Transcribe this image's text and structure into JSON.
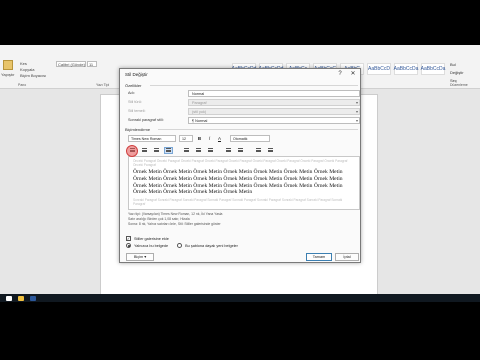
{
  "ribbon": {
    "clipboard": {
      "paste": "Yapıştır",
      "cut": "Kes",
      "copy": "Kopyala",
      "format_painter": "Biçim Boyacısı",
      "group": "Pano"
    },
    "font": {
      "name": "Calibri (Gövde)",
      "size": "11",
      "group": "Yazı Tipi"
    },
    "paragraph_group": "Paragraf",
    "styles": [
      "AaBbCcDd",
      "AaBbCcDd",
      "AaBbCc",
      "AaBbCcC",
      "AaBbC",
      "AaBbCcD",
      "AaBbCcDa",
      "AaBbCcDa"
    ],
    "editing": {
      "find": "Bul",
      "replace": "Değiştir",
      "select": "Seç",
      "group": "Düzenleme"
    }
  },
  "statusbar": {
    "page": "SAYFA 1/1",
    "words": "0 SÖZCÜK",
    "zoom": "%100"
  },
  "dialog": {
    "title": "Stil Değiştir",
    "help": "?",
    "close": "✕",
    "properties_header": "Özellikler",
    "rows": [
      {
        "label": "Adı:",
        "value": "Normal",
        "disabled": false,
        "dropdown": false
      },
      {
        "label": "Stil türü:",
        "value": "Paragraf",
        "disabled": true,
        "dropdown": true
      },
      {
        "label": "Stil temeli:",
        "value": "(stil yok)",
        "disabled": true,
        "dropdown": true
      },
      {
        "label": "Sonraki paragraf stili:",
        "value": "¶ Normal",
        "disabled": false,
        "dropdown": true
      }
    ],
    "formatting_header": "Biçimlendirme",
    "font_name": "Times New Roman",
    "font_size": "12",
    "bold": "B",
    "italic": "İ",
    "underline": "A",
    "color_label": "Otomatik",
    "script": "Latin",
    "preview": {
      "prev_line": "Önceki Paragraf Önceki Paragraf Önceki Paragraf Önceki Paragraf Önceki Paragraf Önceki Paragraf Önceki Paragraf Önceki Paragraf Önceki Paragraf Önceki Paragraf",
      "sample_1": "Örnek Metin Örnek Metin Örnek Metin Örnek Metin Örnek Metin Örnek Metin Örnek Metin",
      "sample_2": "Örnek Metin Örnek Metin Örnek Metin Örnek Metin Örnek Metin Örnek Metin Örnek Metin",
      "sample_3": "Örnek Metin Örnek Metin Örnek Metin Örnek Metin Örnek Metin Örnek Metin Örnek Metin",
      "sample_4": "Örnek Metin Örnek Metin Örnek Metin Örnek Metin",
      "next_line": "Sonraki Paragraf Sonraki Paragraf Sonraki Paragraf Sonraki Paragraf Sonraki Paragraf Sonraki Paragraf Sonraki Paragraf Sonraki Paragraf Sonraki Paragraf"
    },
    "description": [
      "Yazı tipi: (Varsayılan) Times New Roman, 12 nk, İki Yana Yasla",
      "   Satır aralığı:  Birden çok 1,08 satır, Hizala",
      "   Sonra:  8 nk, Yalnız satırları önle, Stil: Stiller galerisinde göster"
    ],
    "add_to_gallery": "Stiller galerisine ekle",
    "option_this_doc": "Yalnızca bu belgede",
    "option_template": "Bu şablona dayalı yeni belgeler",
    "format_button": "Biçim ▾",
    "ok": "Tamam",
    "cancel": "İptal"
  }
}
